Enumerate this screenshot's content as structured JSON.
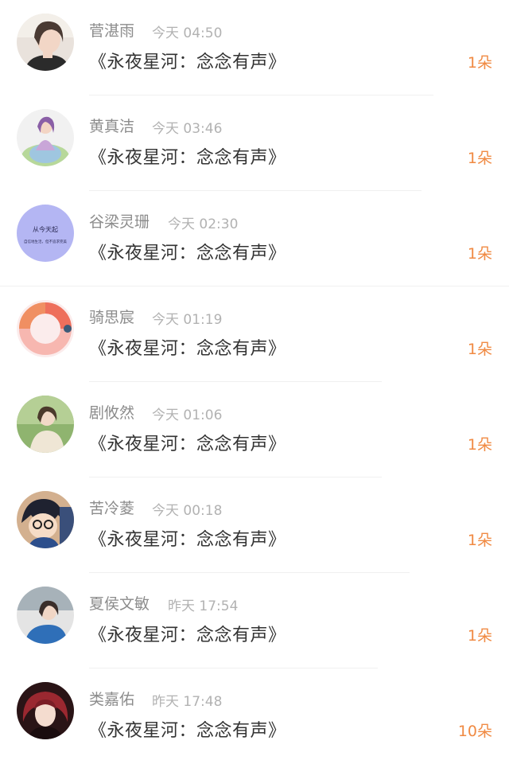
{
  "accent_color": "#f08a43",
  "items": [
    {
      "name": "菅湛雨",
      "time": "今天 04:50",
      "title": "《永夜星河：念念有声》",
      "count": "1朵",
      "avatar": "photo-avatar"
    },
    {
      "name": "黄真洁",
      "time": "今天 03:46",
      "title": "《永夜星河：念念有声》",
      "count": "1朵",
      "avatar": "illustration-avatar"
    },
    {
      "name": "谷梁灵珊",
      "time": "今天 02:30",
      "title": "《永夜星河：念念有声》",
      "count": "1朵",
      "avatar": "text-avatar",
      "avatar_text_1": "从今天起",
      "avatar_text_2": "自信地生活，但不追求完美"
    },
    {
      "name": "骑思宸",
      "time": "今天 01:19",
      "title": "《永夜星河：念念有声》",
      "count": "1朵",
      "avatar": "ring-avatar"
    },
    {
      "name": "剧攸然",
      "time": "今天 01:06",
      "title": "《永夜星河：念念有声》",
      "count": "1朵",
      "avatar": "photo-avatar"
    },
    {
      "name": "苦冷菱",
      "time": "今天 00:18",
      "title": "《永夜星河：念念有声》",
      "count": "1朵",
      "avatar": "anime-avatar"
    },
    {
      "name": "夏侯文敏",
      "time": "昨天 17:54",
      "title": "《永夜星河：念念有声》",
      "count": "1朵",
      "avatar": "photo-avatar"
    },
    {
      "name": "类嘉佑",
      "time": "昨天 17:48",
      "title": "《永夜星河：念念有声》",
      "count": "10朵",
      "avatar": "photo-avatar"
    }
  ]
}
